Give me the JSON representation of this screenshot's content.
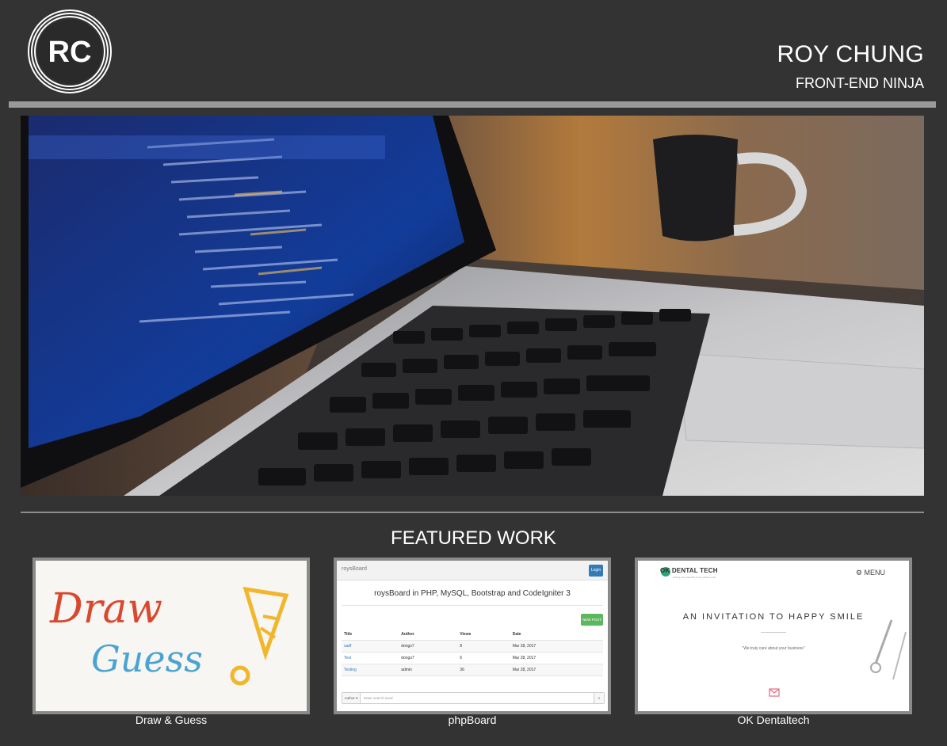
{
  "header": {
    "logo_text": "RC",
    "name": "ROY CHUNG",
    "tagline": "FRONT-END NINJA"
  },
  "hero": {
    "image_description": "laptop-with-code-and-coffee-mug"
  },
  "featured": {
    "title": "FEATURED WORK",
    "projects": [
      {
        "caption": "Draw & Guess",
        "thumb_text_1": "Draw",
        "thumb_text_2": "Guess"
      },
      {
        "caption": "phpBoard",
        "brand": "roysBoard",
        "login": "Login",
        "heading": "roysBoard in PHP, MySQL, Bootstrap and CodeIgniter 3",
        "new_post": "NEW POST",
        "columns": [
          "Title",
          "Author",
          "Views",
          "Date"
        ],
        "rows": [
          [
            "sadf",
            "dongs7",
            "8",
            "Mar 28, 2017"
          ],
          [
            "Test",
            "dongs7",
            "6",
            "Mar 28, 2017"
          ],
          [
            "Testing",
            "admin",
            "36",
            "Mar 28, 2017"
          ]
        ],
        "search_author": "Author ▾",
        "search_placeholder": "Enter search word"
      },
      {
        "caption": "OK Dentaltech",
        "logo": "OK DENTAL TECH",
        "logo_sub": "Setting new standard in the perfect smile",
        "menu": "MENU",
        "headline": "AN INVITATION TO HAPPY SMILE",
        "quote": "\"We truly care about your business\""
      }
    ]
  },
  "colors": {
    "background": "#333333",
    "rule": "#9a9a9a",
    "card_border": "#8a8a8a"
  }
}
